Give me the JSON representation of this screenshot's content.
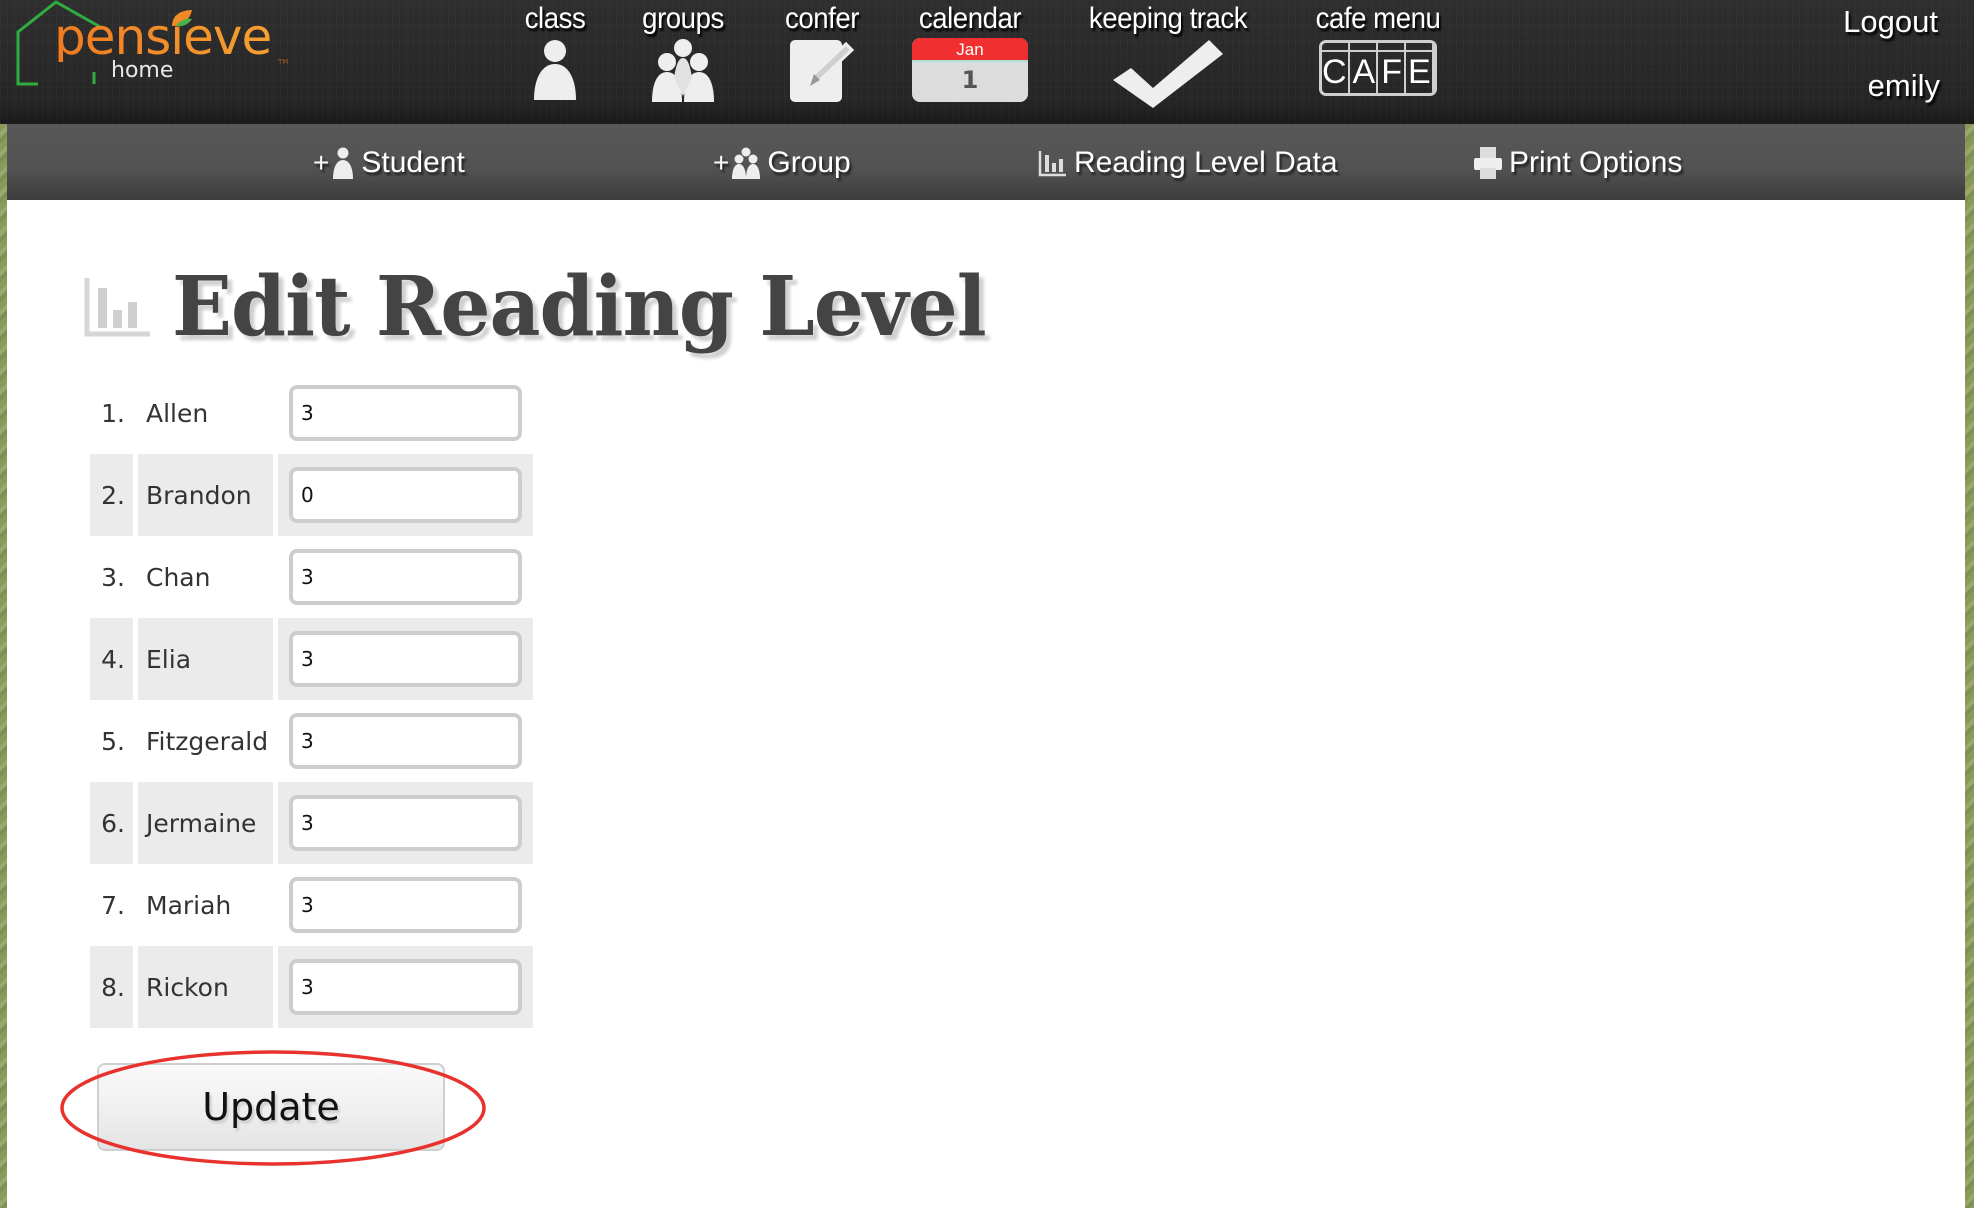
{
  "logo": {
    "brand": "pensieve",
    "sub": "home",
    "tm": "TM"
  },
  "top_nav": [
    {
      "label": "class",
      "icon": "person-icon"
    },
    {
      "label": "groups",
      "icon": "group-icon"
    },
    {
      "label": "confer",
      "icon": "notepad-pencil-icon"
    },
    {
      "label": "calendar",
      "icon": "calendar-icon",
      "month": "Jan",
      "day": "1"
    },
    {
      "label": "keeping track",
      "icon": "checkmark-icon"
    },
    {
      "label": "cafe menu",
      "icon": "cafe-sign-icon",
      "sign_text": "CAFE"
    }
  ],
  "user": {
    "logout_label": "Logout",
    "username": "emily"
  },
  "sub_nav": [
    {
      "prefix": "+",
      "label": "Student",
      "icon": "add-student-icon"
    },
    {
      "prefix": "+",
      "label": "Group",
      "icon": "add-group-icon"
    },
    {
      "prefix": "",
      "label": "Reading Level Data",
      "icon": "bar-chart-icon"
    },
    {
      "prefix": "",
      "label": "Print Options",
      "icon": "printer-icon"
    }
  ],
  "page": {
    "title": "Edit Reading Level"
  },
  "students": [
    {
      "num": "1.",
      "name": "Allen",
      "level": "3"
    },
    {
      "num": "2.",
      "name": "Brandon",
      "level": "0"
    },
    {
      "num": "3.",
      "name": "Chan",
      "level": "3"
    },
    {
      "num": "4.",
      "name": "Elia",
      "level": "3"
    },
    {
      "num": "5.",
      "name": "Fitzgerald",
      "level": "3"
    },
    {
      "num": "6.",
      "name": "Jermaine",
      "level": "3"
    },
    {
      "num": "7.",
      "name": "Mariah",
      "level": "3"
    },
    {
      "num": "8.",
      "name": "Rickon",
      "level": "3"
    }
  ],
  "form": {
    "update_label": "Update"
  },
  "colors": {
    "calendar_red": "#f03030",
    "annotation_red": "#e8322e",
    "logo_orange": "#f08a24",
    "logo_green": "#2fae3f"
  }
}
